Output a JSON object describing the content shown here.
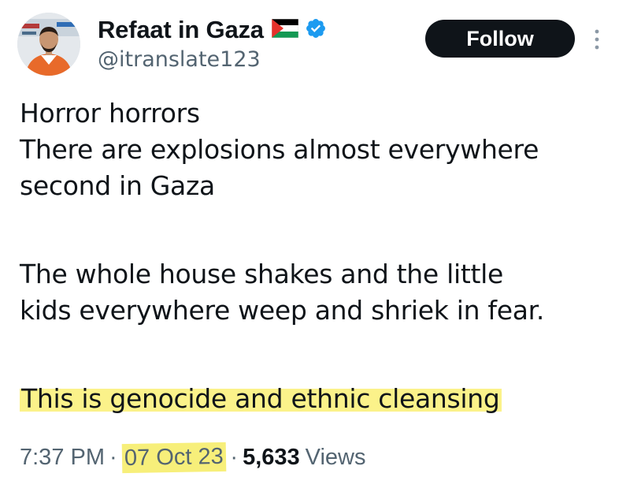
{
  "user": {
    "display_name": "Refaat in Gaza",
    "handle": "@itranslate123",
    "verified": true,
    "flag": "palestine-flag-icon"
  },
  "actions": {
    "follow_label": "Follow",
    "more_icon": "more-vertical-icon"
  },
  "tweet": {
    "lines": [
      "Horror horrors",
      "There are explosions almost everywhere",
      "second in Gaza",
      "The whole house shakes and the little",
      "kids everywhere weep and shriek in fear.",
      "This is genocide and ethnic cleansing"
    ]
  },
  "meta": {
    "time": "7:37 PM",
    "separator": "·",
    "date": "07 Oct 23",
    "views_count": "5,633",
    "views_label": "Views"
  },
  "colors": {
    "text": "#0f1419",
    "muted": "#536471",
    "highlight": "#f7ef7a",
    "verified": "#1d9bf0",
    "follow_bg": "#0f1419"
  }
}
